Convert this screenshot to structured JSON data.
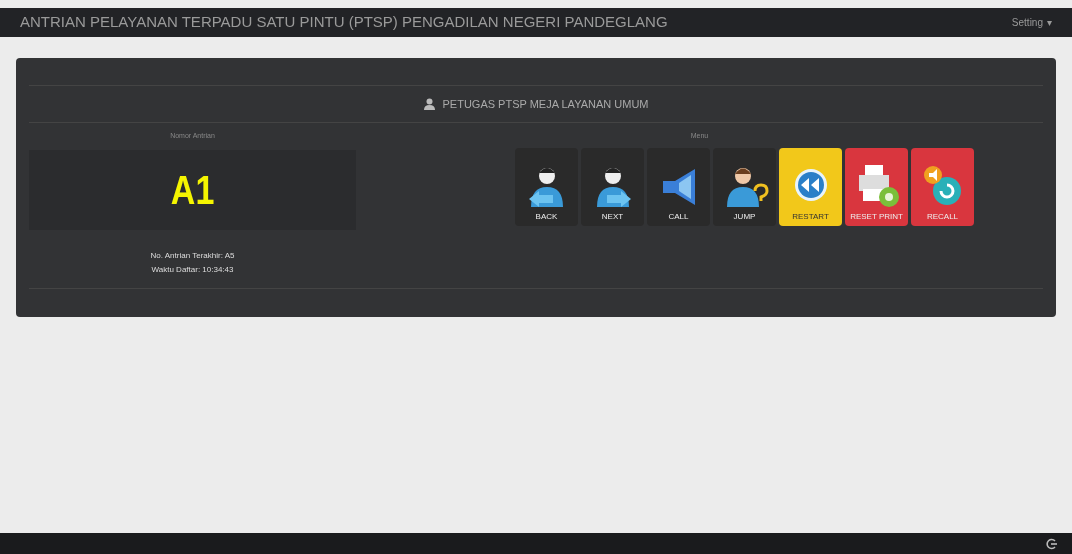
{
  "navbar": {
    "title": "ANTRIAN PELAYANAN TERPADU SATU PINTU (PTSP) PENGADILAN NEGERI PANDEGLANG",
    "menu": "Setting",
    "caret": "▾"
  },
  "panel": {
    "heading": "PETUGAS PTSP MEJA LAYANAN UMUM",
    "queue": {
      "label": "Nomor Antrian",
      "number": "A1",
      "last": "No. Antrian Terakhir: A5",
      "time": "Waktu Daftar: 10:34:43"
    },
    "menu": {
      "label": "Menu",
      "buttons": [
        {
          "label": "BACK",
          "kind": "back",
          "color": "#2a2a2a"
        },
        {
          "label": "NEXT",
          "kind": "next",
          "color": "#2a2a2a"
        },
        {
          "label": "CALL",
          "kind": "call",
          "color": "#2a2a2a"
        },
        {
          "label": "JUMP",
          "kind": "jump",
          "color": "#2a2a2a"
        },
        {
          "label": "RESTART",
          "kind": "rewind",
          "color": "#f2c81a"
        },
        {
          "label": "RESET PRINT",
          "kind": "print",
          "color": "#d9363e"
        },
        {
          "label": "RECALL",
          "kind": "recall",
          "color": "#d9363e"
        }
      ]
    }
  }
}
